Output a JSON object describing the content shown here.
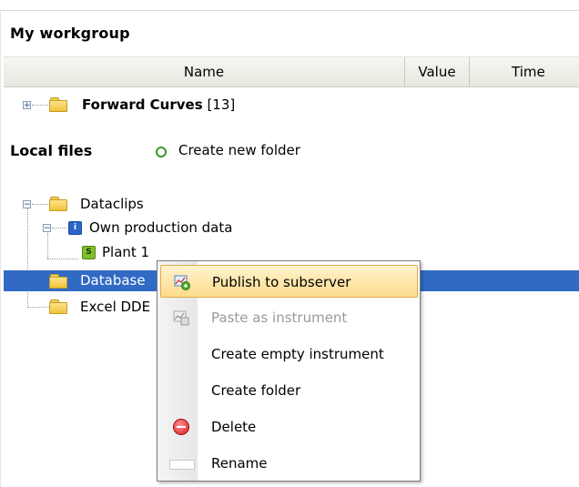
{
  "workgroup": {
    "title": "My workgroup",
    "columns": {
      "name": "Name",
      "value": "Value",
      "time": "Time"
    }
  },
  "tree": {
    "forward_curves": {
      "label": "Forward Curves",
      "count": "[13]"
    },
    "local_files": {
      "title": "Local files",
      "create_folder": "Create new folder"
    },
    "dataclips": "Dataclips",
    "own_production": "Own production data",
    "plant": "Plant 1",
    "database": "Database",
    "excel": "Excel DDE"
  },
  "context_menu": {
    "items": [
      {
        "label": "Publish to subserver",
        "state": "highlighted",
        "icon": "publish-icon"
      },
      {
        "label": "Paste as instrument",
        "state": "disabled",
        "icon": "paste-icon"
      },
      {
        "label": "Create empty instrument",
        "state": "normal",
        "icon": ""
      },
      {
        "label": "Create folder",
        "state": "normal",
        "icon": ""
      },
      {
        "label": "Delete",
        "state": "normal",
        "icon": "delete-icon"
      },
      {
        "label": "Rename",
        "state": "normal",
        "icon": "rename-icon"
      }
    ]
  },
  "colors": {
    "selection": "#316ac5",
    "highlight_item": "#fddb8c",
    "folder": "#f2c23a"
  }
}
